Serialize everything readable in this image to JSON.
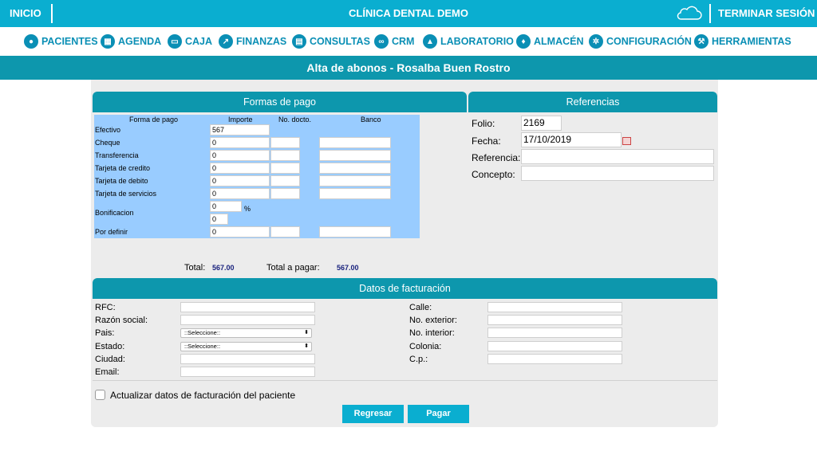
{
  "topbar": {
    "home_label": "INICIO",
    "clinic_name": "CLÍNICA DENTAL DEMO",
    "cloud_icon": "cloud-icon",
    "logout_label": "TERMINAR SESIÓN"
  },
  "nav": {
    "items": [
      {
        "label": "PACIENTES",
        "icon": "patient-icon"
      },
      {
        "label": "AGENDA",
        "icon": "calendar-icon"
      },
      {
        "label": "CAJA",
        "icon": "cash-icon"
      },
      {
        "label": "FINANZAS",
        "icon": "chart-icon"
      },
      {
        "label": "CONSULTAS",
        "icon": "document-icon"
      },
      {
        "label": "CRM",
        "icon": "handshake-icon"
      },
      {
        "label": "LABORATORIO",
        "icon": "flask-icon"
      },
      {
        "label": "ALMACÉN",
        "icon": "tooth-icon"
      },
      {
        "label": "CONFIGURACIÓN",
        "icon": "gears-icon"
      },
      {
        "label": "HERRAMIENTAS",
        "icon": "tools-icon"
      }
    ]
  },
  "page_title": "Alta de abonos - Rosalba Buen Rostro",
  "formas_pago": {
    "title": "Formas de pago",
    "headers": {
      "forma": "Forma de pago",
      "importe": "Importe",
      "docto": "No. docto.",
      "banco": "Banco"
    },
    "rows": [
      {
        "label": "Efectivo",
        "importe": "567"
      },
      {
        "label": "Cheque",
        "importe": "0"
      },
      {
        "label": "Transferencia",
        "importe": "0"
      },
      {
        "label": "Tarjeta de credito",
        "importe": "0"
      },
      {
        "label": "Tarjeta de debito",
        "importe": "0"
      },
      {
        "label": "Tarjeta de servicios",
        "importe": "0"
      },
      {
        "label": "Bonificacion",
        "importe": "0",
        "importe2": "0",
        "unit": "%"
      },
      {
        "label": "Por definir",
        "importe": "0"
      }
    ],
    "total_label": "Total:",
    "total_value": "567.00",
    "total_pagar_label": "Total a pagar:",
    "total_pagar_value": "567.00"
  },
  "referencias": {
    "title": "Referencias",
    "folio_label": "Folio:",
    "folio_value": "2169",
    "fecha_label": "Fecha:",
    "fecha_value": "17/10/2019",
    "referencia_label": "Referencia:",
    "referencia_value": "",
    "concepto_label": "Concepto:",
    "concepto_value": ""
  },
  "facturacion": {
    "title": "Datos de facturación",
    "left": {
      "rfc": "RFC:",
      "razon": "Razón social:",
      "pais": "Pais:",
      "estado": "Estado:",
      "ciudad": "Ciudad:",
      "email": "Email:"
    },
    "select_placeholder": "::Seleccione::",
    "right": {
      "calle": "Calle:",
      "ext": "No. exterior:",
      "int": "No. interior:",
      "colonia": "Colonia:",
      "cp": "C.p.:"
    },
    "update_checkbox_label": "Actualizar datos de facturación del paciente",
    "update_checked": false
  },
  "buttons": {
    "back": "Regresar",
    "pay": "Pagar"
  }
}
